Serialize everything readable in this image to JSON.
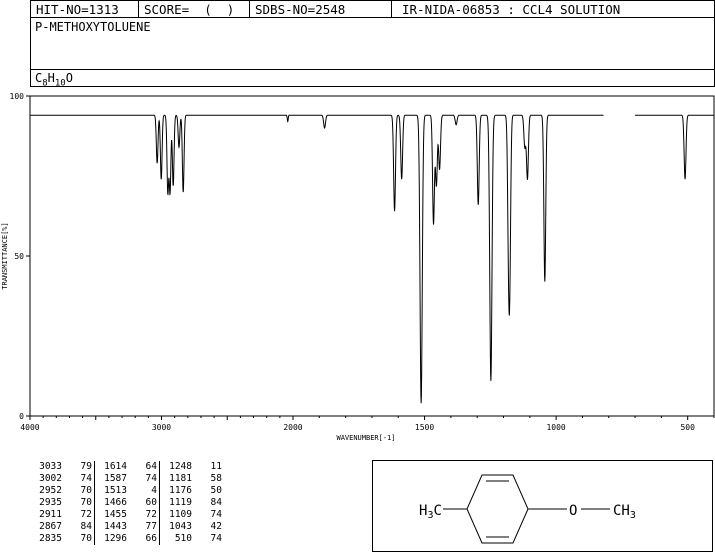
{
  "header": {
    "hit": "HIT-NO=1313",
    "score": "SCORE=  (  )",
    "sdbs": "SDBS-NO=2548",
    "ir": "IR-NIDA-06853 : CCL4 SOLUTION"
  },
  "compound": {
    "name": "P-METHOXYTOLUENE",
    "formula_parts": [
      "C",
      "8",
      "H",
      "10",
      "O"
    ]
  },
  "chart_data": {
    "type": "line",
    "xlabel": "WAVENUMBER[-1]",
    "ylabel": "TRANSMITTANCE[%]",
    "xlim": [
      4000,
      400
    ],
    "ylim": [
      0,
      100
    ],
    "xticks": [
      "4000",
      "3000",
      "2000",
      "1500",
      "1000",
      "500"
    ],
    "xtick_values": [
      4000,
      3000,
      2000,
      1500,
      1000,
      500
    ],
    "yticks": [
      "0",
      "50",
      "100"
    ],
    "ytick_values": [
      0,
      50,
      100
    ],
    "gap": [
      820,
      700
    ],
    "baseline": 94,
    "peaks": [
      {
        "x": 3033,
        "y": 79
      },
      {
        "x": 3002,
        "y": 74
      },
      {
        "x": 2952,
        "y": 70
      },
      {
        "x": 2935,
        "y": 70
      },
      {
        "x": 2911,
        "y": 72
      },
      {
        "x": 2867,
        "y": 84
      },
      {
        "x": 2835,
        "y": 70
      },
      {
        "x": 2040,
        "y": 92
      },
      {
        "x": 1880,
        "y": 90
      },
      {
        "x": 1614,
        "y": 64
      },
      {
        "x": 1587,
        "y": 74
      },
      {
        "x": 1513,
        "y": 4
      },
      {
        "x": 1466,
        "y": 60
      },
      {
        "x": 1455,
        "y": 72
      },
      {
        "x": 1443,
        "y": 77
      },
      {
        "x": 1380,
        "y": 91
      },
      {
        "x": 1296,
        "y": 66
      },
      {
        "x": 1248,
        "y": 11
      },
      {
        "x": 1181,
        "y": 58
      },
      {
        "x": 1176,
        "y": 50
      },
      {
        "x": 1119,
        "y": 84
      },
      {
        "x": 1109,
        "y": 74
      },
      {
        "x": 1043,
        "y": 42
      },
      {
        "x": 510,
        "y": 74
      }
    ],
    "table": [
      [
        "3033",
        "79",
        "1614",
        "64",
        "1248",
        "11"
      ],
      [
        "3002",
        "74",
        "1587",
        "74",
        "1181",
        "58"
      ],
      [
        "2952",
        "70",
        "1513",
        "4",
        "1176",
        "50"
      ],
      [
        "2935",
        "70",
        "1466",
        "60",
        "1119",
        "84"
      ],
      [
        "2911",
        "72",
        "1455",
        "72",
        "1109",
        "74"
      ],
      [
        "2867",
        "84",
        "1443",
        "77",
        "1043",
        "42"
      ],
      [
        "2835",
        "70",
        "1296",
        "66",
        "510",
        "74"
      ]
    ]
  },
  "structure": {
    "left_group": [
      "H",
      "3",
      "C"
    ],
    "oxygen": "O",
    "right_group": [
      "CH",
      "3"
    ]
  }
}
